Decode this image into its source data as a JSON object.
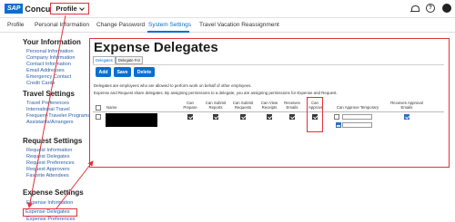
{
  "topbar": {
    "brand_sap": "SAP",
    "brand_name": "Concur",
    "profile_label": "Profile",
    "help_icon_glyph": "?",
    "user_icon_glyph": "●"
  },
  "tabs": [
    {
      "label": "Profile"
    },
    {
      "label": "Personal Information"
    },
    {
      "label": "Change Password"
    },
    {
      "label": "System Settings"
    },
    {
      "label": "Travel Vacation Reassignment"
    }
  ],
  "sidebar": {
    "sections": [
      {
        "title": "Your Information",
        "items": [
          "Personal Information",
          "Company Information",
          "Contact Information",
          "Email Addresses",
          "Emergency Contact",
          "Credit Cards"
        ]
      },
      {
        "title": "Travel Settings",
        "items": [
          "Travel Preferences",
          "International Travel",
          "Frequent-Traveler Programs",
          "Assistants/Arrangers"
        ]
      },
      {
        "title": "Request Settings",
        "items": [
          "Request Information",
          "Request Delegates",
          "Request Preferences",
          "Request Approvers",
          "Favorite Attendees"
        ]
      },
      {
        "title": "Expense Settings",
        "items": [
          "Expense Information",
          "Expense Delegates",
          "Expense Preferences"
        ]
      }
    ],
    "active_item": "Expense Delegates"
  },
  "main": {
    "title": "Expense Delegates",
    "subtabs": [
      "Delegates",
      "Delegate For"
    ],
    "buttons": {
      "add": "Add",
      "save": "Save",
      "delete": "Delete"
    },
    "info_line_1": "Delegates are employees who are allowed to perform work on behalf of other employees.",
    "info_line_2": "Expense and Request share delegates. By assigning permissions to a delegate, you are assigning permissions for Expense and Request.",
    "columns": {
      "name": "Name",
      "can_prepare": "Can Prepare",
      "can_submit_reports": "Can Submit Reports",
      "can_submit_requests": "Can Submit Requests",
      "can_view_receipts": "Can View Receipts",
      "receives_emails": "Receives Emails",
      "can_approve": "Can Approve",
      "can_approve_temporary": "Can Approve Temporary",
      "receives_approval_emails": "Receives Approval Emails"
    },
    "row": {
      "selected": false,
      "can_prepare": true,
      "can_submit_reports": true,
      "can_submit_requests": true,
      "can_view_receipts": true,
      "receives_emails": true,
      "can_approve": true,
      "can_approve_temporary": false,
      "receives_approval_emails": true
    }
  },
  "colors": {
    "accent": "#0a6ed1",
    "highlight": "#e0323c",
    "link": "#2a5fa8"
  }
}
